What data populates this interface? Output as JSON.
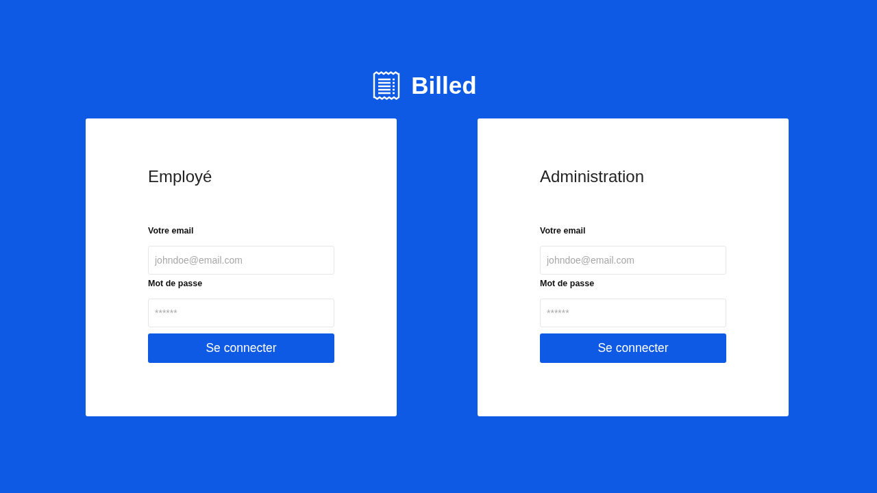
{
  "header": {
    "logo_text": "Billed"
  },
  "forms": [
    {
      "title": "Employé",
      "email": {
        "label": "Votre email",
        "placeholder": "johndoe@email.com"
      },
      "password": {
        "label": "Mot de passe",
        "placeholder": "******"
      },
      "button": "Se connecter"
    },
    {
      "title": "Administration",
      "email": {
        "label": "Votre email",
        "placeholder": "johndoe@email.com"
      },
      "password": {
        "label": "Mot de passe",
        "placeholder": "******"
      },
      "button": "Se connecter"
    }
  ]
}
